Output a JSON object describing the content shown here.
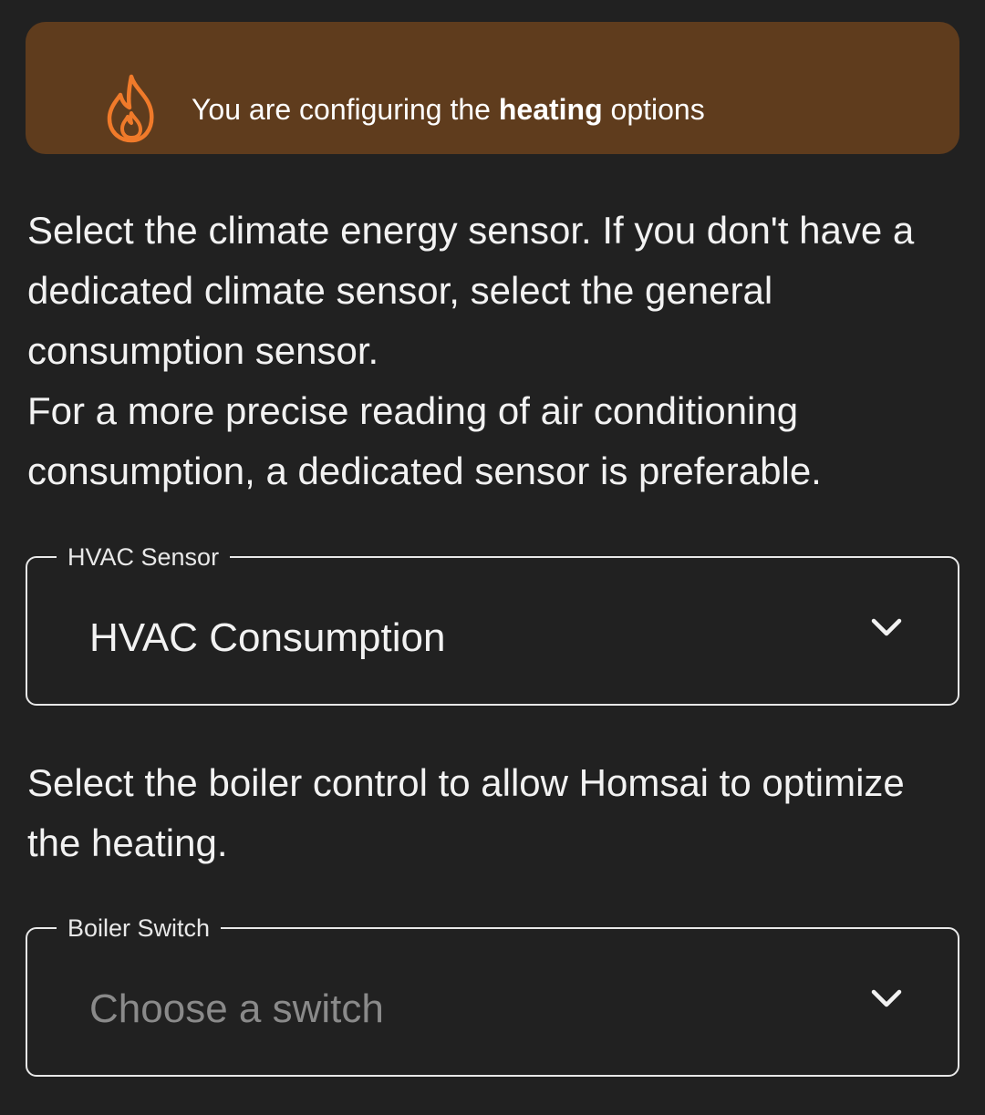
{
  "banner": {
    "text_before": "You are configuring the ",
    "text_bold": "heating",
    "text_after": " options",
    "icon": "flame-icon",
    "icon_color": "#f07a2a",
    "background": "#5f3c1d"
  },
  "hvac_section": {
    "description_line1": "Select the climate energy sensor. If you don't have a dedicated climate sensor, select the general consumption sensor.",
    "description_line2": "For a more precise reading of air conditioning consumption, a dedicated sensor is preferable.",
    "field_label": "HVAC Sensor",
    "selected_value": "HVAC Consumption"
  },
  "boiler_section": {
    "description": "Select the boiler control to allow Homsai to optimize the heating.",
    "field_label": "Boiler Switch",
    "placeholder": "Choose a switch"
  },
  "icons": {
    "dropdown": "chevron-down-icon"
  }
}
